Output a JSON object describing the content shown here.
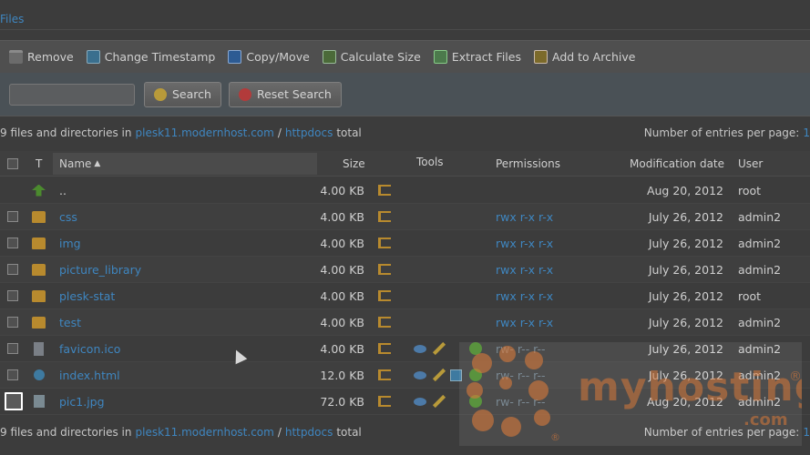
{
  "breadcrumb": {
    "title": "Files"
  },
  "toolbar": {
    "remove": "Remove",
    "change_timestamp": "Change Timestamp",
    "copy_move": "Copy/Move",
    "calculate_size": "Calculate Size",
    "extract_files": "Extract Files",
    "add_to_archive": "Add to Archive"
  },
  "search": {
    "input_value": "",
    "search_label": "Search",
    "reset_label": "Reset Search"
  },
  "summary": {
    "prefix": "9 files and directories in",
    "domain": "plesk11.modernhost.com",
    "sep": "/",
    "folder": "httpdocs",
    "suffix": "total",
    "entries_label": "Number of entries per page:",
    "entries_value": "1"
  },
  "table": {
    "headers": {
      "type": "T",
      "name": "Name",
      "size": "Size",
      "tools": "Tools",
      "permissions": "Permissions",
      "modification_date": "Modification date",
      "user": "User"
    },
    "rows": [
      {
        "name": "..",
        "size": "4.00 KB",
        "permissions": "",
        "date": "Aug 20, 2012",
        "user": "root"
      },
      {
        "name": "css",
        "size": "4.00 KB",
        "permissions": "rwx r-x r-x",
        "date": "July 26, 2012",
        "user": "admin2"
      },
      {
        "name": "img",
        "size": "4.00 KB",
        "permissions": "rwx r-x r-x",
        "date": "July 26, 2012",
        "user": "admin2"
      },
      {
        "name": "picture_library",
        "size": "4.00 KB",
        "permissions": "rwx r-x r-x",
        "date": "July 26, 2012",
        "user": "admin2"
      },
      {
        "name": "plesk-stat",
        "size": "4.00 KB",
        "permissions": "rwx r-x r-x",
        "date": "July 26, 2012",
        "user": "root"
      },
      {
        "name": "test",
        "size": "4.00 KB",
        "permissions": "rwx r-x r-x",
        "date": "July 26, 2012",
        "user": "admin2"
      },
      {
        "name": "favicon.ico",
        "size": "4.00 KB",
        "permissions": "rw- r-- r--",
        "date": "July 26, 2012",
        "user": "admin2"
      },
      {
        "name": "index.html",
        "size": "12.0 KB",
        "permissions": "rw- r-- r--",
        "date": "July 26, 2012",
        "user": "admin2"
      },
      {
        "name": "pic1.jpg",
        "size": "72.0 KB",
        "permissions": "rw- r-- r--",
        "date": "Aug 20, 2012",
        "user": "admin2"
      }
    ]
  },
  "watermark": {
    "brand": "myhosting",
    "tld": ".com",
    "reg": "®"
  }
}
